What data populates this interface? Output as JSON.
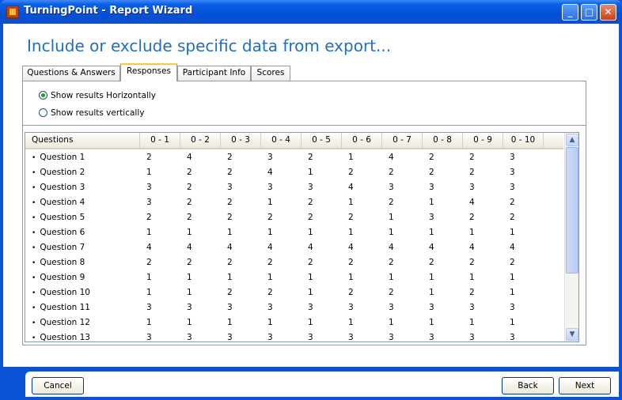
{
  "window": {
    "title": "TurningPoint - Report Wizard",
    "controls": [
      "_",
      "□",
      "✕"
    ]
  },
  "heading": "Include or exclude specific data from export...",
  "tabs": [
    {
      "label": "Questions & Answers",
      "active": false
    },
    {
      "label": "Responses",
      "active": true
    },
    {
      "label": "Participant Info",
      "active": false
    },
    {
      "label": "Scores",
      "active": false
    }
  ],
  "options": {
    "horizontal": {
      "label": "Show results Horizontally",
      "selected": true
    },
    "vertical": {
      "label": "Show results vertically",
      "selected": false
    }
  },
  "table": {
    "columns": [
      "Questions",
      "0 - 1",
      "0 - 2",
      "0 - 3",
      "0 - 4",
      "0 - 5",
      "0 - 6",
      "0 - 7",
      "0 - 8",
      "0 - 9",
      "0 - 10"
    ],
    "rows": [
      {
        "q": "Question 1",
        "v": [
          "2",
          "4",
          "2",
          "3",
          "2",
          "1",
          "4",
          "2",
          "2",
          "3"
        ]
      },
      {
        "q": "Question 2",
        "v": [
          "1",
          "2",
          "2",
          "4",
          "1",
          "2",
          "2",
          "2",
          "2",
          "3"
        ]
      },
      {
        "q": "Question 3",
        "v": [
          "3",
          "2",
          "3",
          "3",
          "3",
          "4",
          "3",
          "3",
          "3",
          "3"
        ]
      },
      {
        "q": "Question 4",
        "v": [
          "3",
          "2",
          "2",
          "1",
          "2",
          "1",
          "2",
          "1",
          "4",
          "2"
        ]
      },
      {
        "q": "Question 5",
        "v": [
          "2",
          "2",
          "2",
          "2",
          "2",
          "2",
          "1",
          "3",
          "2",
          "2"
        ]
      },
      {
        "q": "Question 6",
        "v": [
          "1",
          "1",
          "1",
          "1",
          "1",
          "1",
          "1",
          "1",
          "1",
          "1"
        ]
      },
      {
        "q": "Question 7",
        "v": [
          "4",
          "4",
          "4",
          "4",
          "4",
          "4",
          "4",
          "4",
          "4",
          "4"
        ]
      },
      {
        "q": "Question 8",
        "v": [
          "2",
          "2",
          "2",
          "2",
          "2",
          "2",
          "2",
          "2",
          "2",
          "2"
        ]
      },
      {
        "q": "Question 9",
        "v": [
          "1",
          "1",
          "1",
          "1",
          "1",
          "1",
          "1",
          "1",
          "1",
          "1"
        ]
      },
      {
        "q": "Question 10",
        "v": [
          "1",
          "1",
          "2",
          "2",
          "1",
          "2",
          "2",
          "1",
          "2",
          "1"
        ]
      },
      {
        "q": "Question 11",
        "v": [
          "3",
          "3",
          "3",
          "3",
          "3",
          "3",
          "3",
          "3",
          "3",
          "3"
        ]
      },
      {
        "q": "Question 12",
        "v": [
          "1",
          "1",
          "1",
          "1",
          "1",
          "1",
          "1",
          "1",
          "1",
          "1"
        ]
      },
      {
        "q": "Question 13",
        "v": [
          "3",
          "3",
          "3",
          "3",
          "3",
          "3",
          "3",
          "3",
          "3",
          "3"
        ]
      }
    ]
  },
  "buttons": {
    "cancel": "Cancel",
    "back": "Back",
    "next": "Next"
  },
  "scroll": {
    "up_icon": "▲",
    "down_icon": "▼"
  }
}
